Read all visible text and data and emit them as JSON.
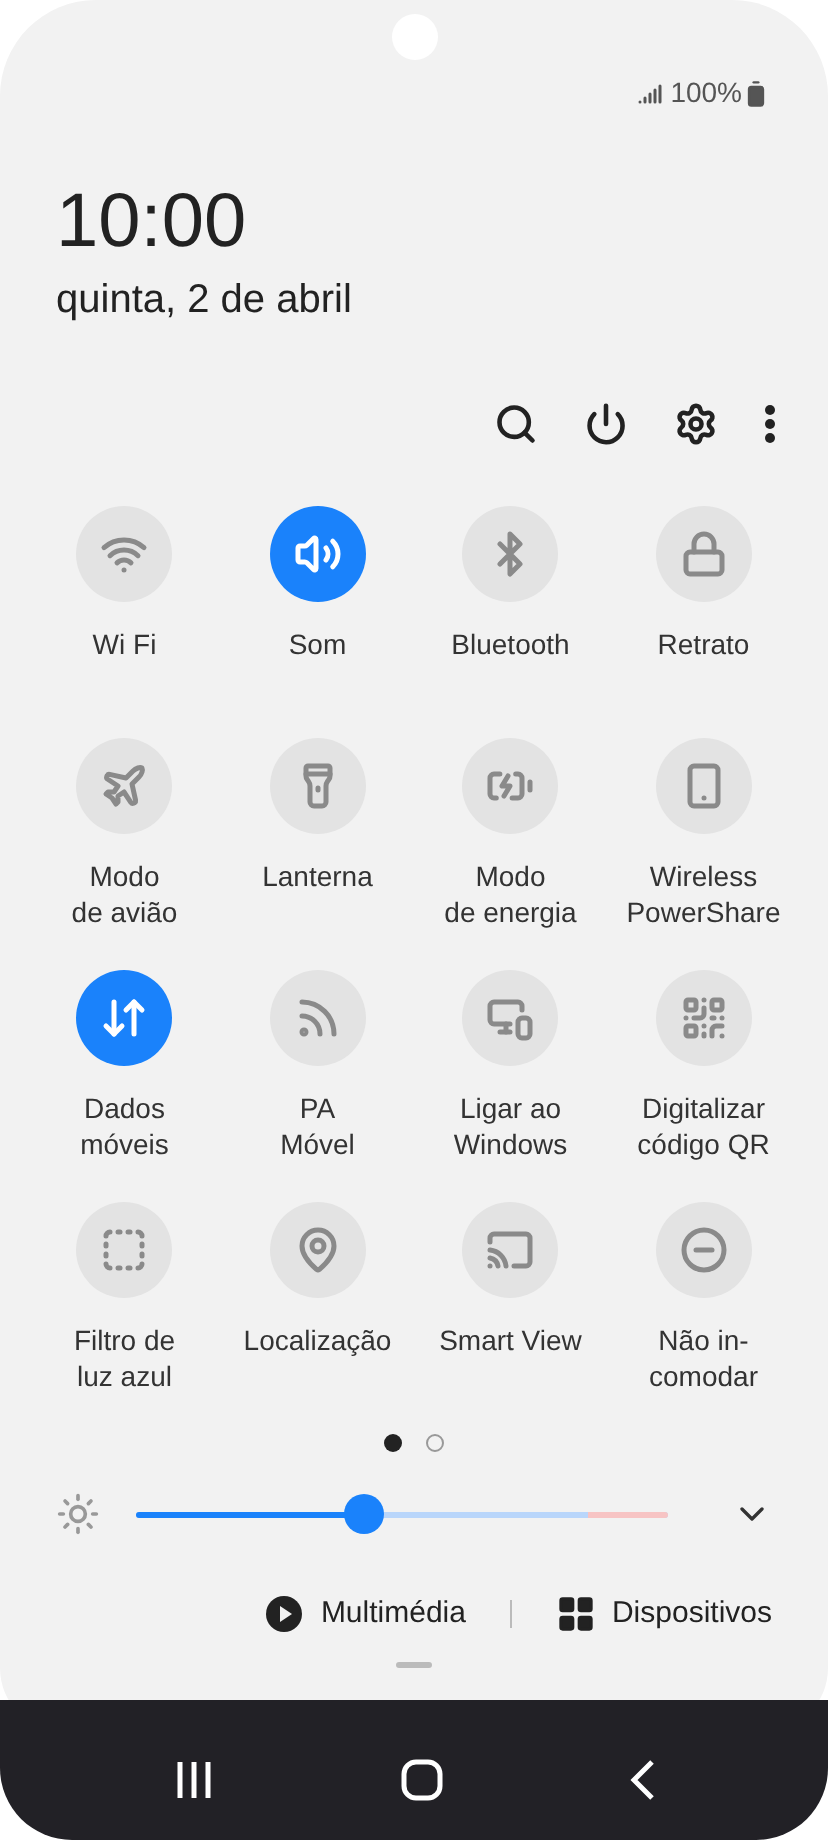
{
  "status_bar": {
    "battery": "100%"
  },
  "clock": {
    "time": "10:00",
    "date": "quinta, 2 de abril"
  },
  "tiles": [
    {
      "label": "Wi Fi",
      "on": false
    },
    {
      "label": "Som",
      "on": true
    },
    {
      "label": "Bluetooth",
      "on": false
    },
    {
      "label": "Retrato",
      "on": false
    },
    {
      "label": "Modo\nde avião",
      "on": false
    },
    {
      "label": "Lanterna",
      "on": false
    },
    {
      "label": "Modo\nde energia",
      "on": false
    },
    {
      "label": "Wireless\nPowerShare",
      "on": false
    },
    {
      "label": "Dados\nmóveis",
      "on": true
    },
    {
      "label": "PA\nMóvel",
      "on": false
    },
    {
      "label": "Ligar ao\nWindows",
      "on": false
    },
    {
      "label": "Digitalizar\ncódigo QR",
      "on": false
    },
    {
      "label": "Filtro de\nluz azul",
      "on": false
    },
    {
      "label": "Localização",
      "on": false
    },
    {
      "label": "Smart View",
      "on": false
    },
    {
      "label": "Não in-\ncomodar",
      "on": false
    }
  ],
  "pages": [
    {
      "selected": true
    },
    {
      "selected": false
    }
  ],
  "brightness": {
    "level": 0.43
  },
  "bottom_buttons": [
    {
      "label": "Multimédia"
    },
    {
      "label": "Dispositivos"
    }
  ]
}
